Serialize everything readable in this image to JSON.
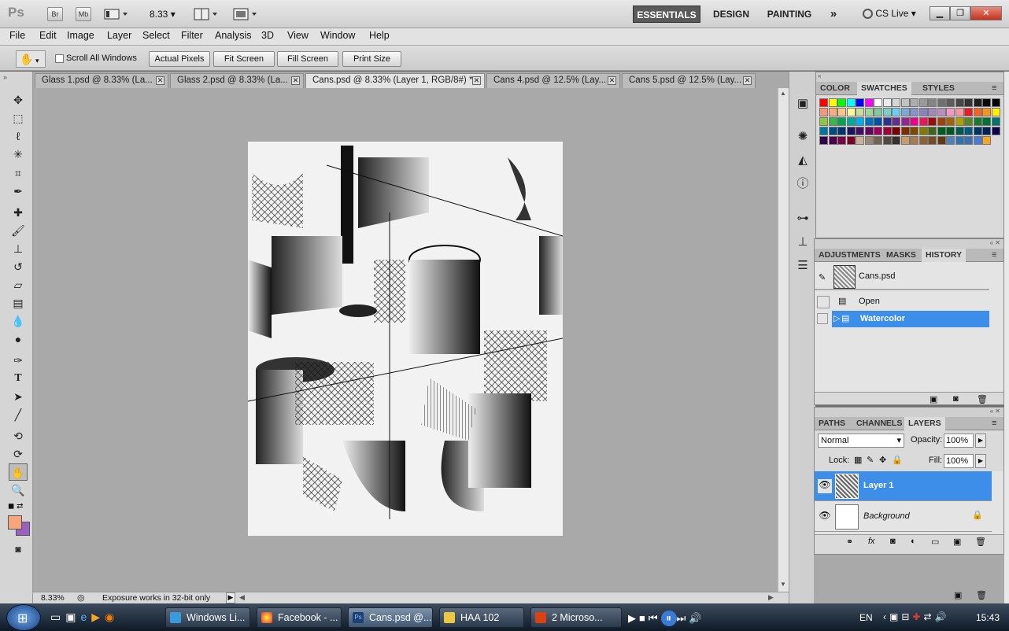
{
  "appbar": {
    "logo": "Ps",
    "br": "Br",
    "mb": "Mb",
    "zoom": "8.33",
    "workspaces": [
      "ESSENTIALS",
      "DESIGN",
      "PAINTING"
    ],
    "more": "»",
    "cslive": "CS Live"
  },
  "menu": [
    "File",
    "Edit",
    "Image",
    "Layer",
    "Select",
    "Filter",
    "Analysis",
    "3D",
    "View",
    "Window",
    "Help"
  ],
  "options": {
    "scroll_all": "Scroll All Windows",
    "actual_pixels": "Actual Pixels",
    "fit_screen": "Fit Screen",
    "fill_screen": "Fill Screen",
    "print_size": "Print Size"
  },
  "tabs": [
    {
      "label": "Glass 1.psd @ 8.33% (La...",
      "active": false
    },
    {
      "label": "Glass 2.psd @ 8.33% (La...",
      "active": false
    },
    {
      "label": "Cans.psd @ 8.33% (Layer 1, RGB/8#) *",
      "active": true
    },
    {
      "label": "Cans 4.psd @ 12.5% (Lay...",
      "active": false
    },
    {
      "label": "Cans 5.psd @ 12.5% (Lay...",
      "active": false
    }
  ],
  "status": {
    "zoom": "8.33%",
    "message": "Exposure works in 32-bit only"
  },
  "swatch_panel": {
    "tabs": [
      "COLOR",
      "SWATCHES",
      "STYLES"
    ],
    "colors": [
      "#ff0000",
      "#ffff00",
      "#00ff00",
      "#00ffff",
      "#0000ff",
      "#ff00ff",
      "#ffffff",
      "#ebebeb",
      "#d6d6d6",
      "#c2c2c2",
      "#adadad",
      "#999999",
      "#858585",
      "#707070",
      "#5c5c5c",
      "#474747",
      "#333333",
      "#1f1f1f",
      "#0a0a0a",
      "#000000",
      "#f7977a",
      "#f9ad81",
      "#fdc68a",
      "#fff79a",
      "#c4df9b",
      "#a3d39c",
      "#82ca9d",
      "#7bcdc8",
      "#6ecff6",
      "#7ea7d8",
      "#8493ca",
      "#8882be",
      "#a187be",
      "#bc8dbf",
      "#f49ac2",
      "#f6989d",
      "#ed1c24",
      "#f26522",
      "#f7941d",
      "#fff200",
      "#8dc63f",
      "#39b54a",
      "#00a651",
      "#00a99d",
      "#00aeef",
      "#0072bc",
      "#0054a6",
      "#2e3192",
      "#662d91",
      "#92278f",
      "#ec008c",
      "#ed145b",
      "#9e0b0f",
      "#a0410d",
      "#a36209",
      "#aba000",
      "#598527",
      "#1a7b30",
      "#007236",
      "#00746b",
      "#0076a3",
      "#004b80",
      "#003471",
      "#1b1464",
      "#440e62",
      "#630460",
      "#9e005d",
      "#9e0039",
      "#790000",
      "#7b2e00",
      "#7d4900",
      "#827b00",
      "#406618",
      "#005e20",
      "#005826",
      "#005952",
      "#005b7f",
      "#003663",
      "#002157",
      "#0d004c",
      "#32004b",
      "#4b0049",
      "#7b0046",
      "#7a0026",
      "#c7b299",
      "#998675",
      "#736357",
      "#534741",
      "#37302d",
      "#c69c6d",
      "#a67c52",
      "#8c6239",
      "#754c24",
      "#603913",
      "#4f81bd",
      "#2e74b5",
      "#3f6fb0",
      "#4b7bd0",
      "#f5a623"
    ]
  },
  "history_panel": {
    "tabs": [
      "ADJUSTMENTS",
      "MASKS",
      "HISTORY"
    ],
    "snapshot": "Cans.psd",
    "items": [
      {
        "label": "Open",
        "selected": false
      },
      {
        "label": "Watercolor",
        "selected": true
      }
    ]
  },
  "layers_panel": {
    "tabs": [
      "PATHS",
      "CHANNELS",
      "LAYERS"
    ],
    "blend_mode": "Normal",
    "opacity_label": "Opacity:",
    "opacity": "100%",
    "lock_label": "Lock:",
    "fill_label": "Fill:",
    "fill": "100%",
    "layers": [
      {
        "name": "Layer 1",
        "selected": true
      },
      {
        "name": "Background",
        "selected": false
      }
    ]
  },
  "taskbar": {
    "items": [
      "Windows Li...",
      "Facebook - ...",
      "Cans.psd @...",
      "HAA 102",
      "2 Microso..."
    ],
    "lang": "EN",
    "time": "15:43"
  },
  "colors": {
    "accent": "#3d8ee8",
    "foreground": "#f7a57a",
    "background": "#9b5fc0"
  }
}
